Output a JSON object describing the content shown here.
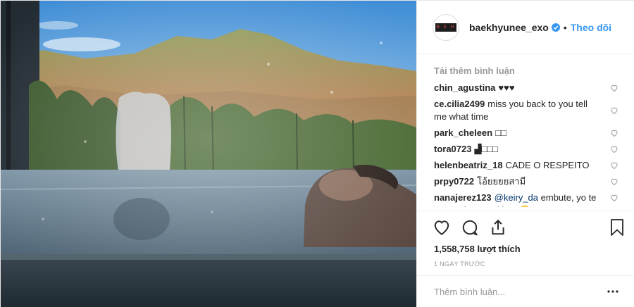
{
  "post": {
    "author": "baekhyunee_exo",
    "avatar_text": "B E H",
    "separator": "•",
    "follow_label": "Theo dõi",
    "load_more_label": "Tải thêm bình luận",
    "comments": [
      {
        "user": "chin_agustina",
        "text": "♥♥♥"
      },
      {
        "user": "ce.cilia2499",
        "text": "miss you back to you tell me what time"
      },
      {
        "user": "park_cheleen",
        "text": "□□"
      },
      {
        "user": "tora0723",
        "text": "▟□□□"
      },
      {
        "user": "helenbeatriz_18",
        "text": "CADE O RESPEITO"
      },
      {
        "user": "prpy0722",
        "text": "โอ้ยยยยสามี"
      },
      {
        "user": "nanajerez123",
        "mention": "@keiry_da",
        "text": "embute, yo te amo más que el knor🙄"
      }
    ],
    "likes": "1,558,758 lượt thích",
    "time_ago": "1 NGÀY TRƯỚC",
    "add_comment_placeholder": "Thêm bình luận...",
    "icons": [
      "heart-icon",
      "comment-icon",
      "share-icon",
      "bookmark-icon",
      "more-options-icon",
      "verified-badge-icon"
    ],
    "colors": {
      "link": "#3897f0",
      "muted": "#999999",
      "text": "#262626",
      "border": "#efefef"
    }
  }
}
